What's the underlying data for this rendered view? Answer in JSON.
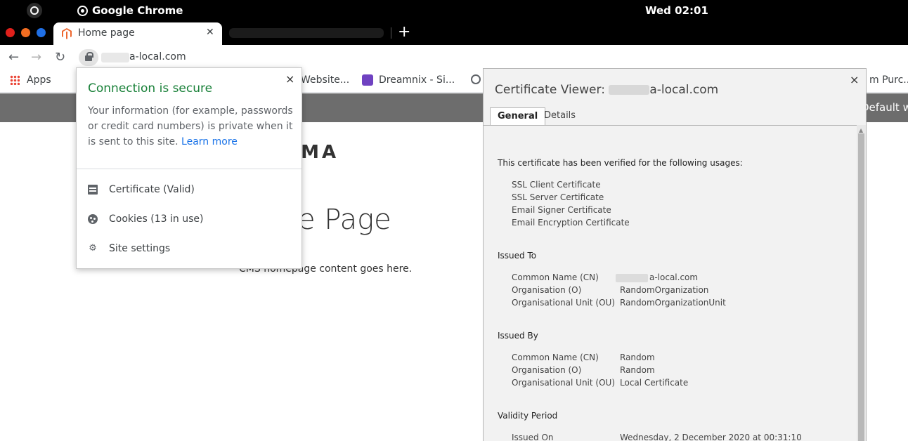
{
  "system": {
    "app_name": "Google Chrome",
    "clock": "Wed 02:01"
  },
  "browser": {
    "tab_title": "Home page",
    "url": "a-local.com",
    "bookmarks": {
      "apps": "Apps",
      "item2": "Website...",
      "item3": "Dreamnix - Si...",
      "item4": "m Purc..."
    }
  },
  "page": {
    "notice_text": "Default we",
    "logo": "UMA",
    "title": "e Page",
    "content": "CMS homepage content goes here."
  },
  "security_popup": {
    "title": "Connection is secure",
    "desc": "Your information (for example, passwords or credit card numbers) is private when it is sent to this site.",
    "learn_more": "Learn more",
    "items": [
      {
        "label": "Certificate (Valid)",
        "icon": "certificate-icon"
      },
      {
        "label": "Cookies (13 in use)",
        "icon": "cookie-icon"
      },
      {
        "label": "Site settings",
        "icon": "gear-icon"
      }
    ],
    "close": "×"
  },
  "cert_viewer": {
    "title_prefix": "Certificate Viewer: ",
    "title_suffix": "a-local.com",
    "close": "×",
    "tabs": [
      "General",
      "Details"
    ],
    "verified_heading": "This certificate has been verified for the following usages:",
    "usages": [
      "SSL Client Certificate",
      "SSL Server Certificate",
      "Email Signer Certificate",
      "Email Encryption Certificate"
    ],
    "issued_to": {
      "heading": "Issued To",
      "rows": [
        {
          "label": "Common Name (CN)",
          "value": "a-local.com"
        },
        {
          "label": "Organisation (O)",
          "value": "RandomOrganization"
        },
        {
          "label": "Organisational Unit (OU)",
          "value": "RandomOrganizationUnit"
        }
      ]
    },
    "issued_by": {
      "heading": "Issued By",
      "rows": [
        {
          "label": "Common Name (CN)",
          "value": "Random"
        },
        {
          "label": "Organisation (O)",
          "value": "Random"
        },
        {
          "label": "Organisational Unit (OU)",
          "value": "Local Certificate"
        }
      ]
    },
    "validity": {
      "heading": "Validity Period",
      "rows": [
        {
          "label": "Issued On",
          "value": "Wednesday, 2 December 2020 at 00:31:10"
        }
      ]
    }
  },
  "colors": {
    "secure_green": "#188038",
    "link_blue": "#1a73e8",
    "notice_bg": "#6d6d6d",
    "close_red": "#e0201b",
    "minimize_orange": "#f26d21",
    "maximize_blue": "#1f6fe5"
  }
}
